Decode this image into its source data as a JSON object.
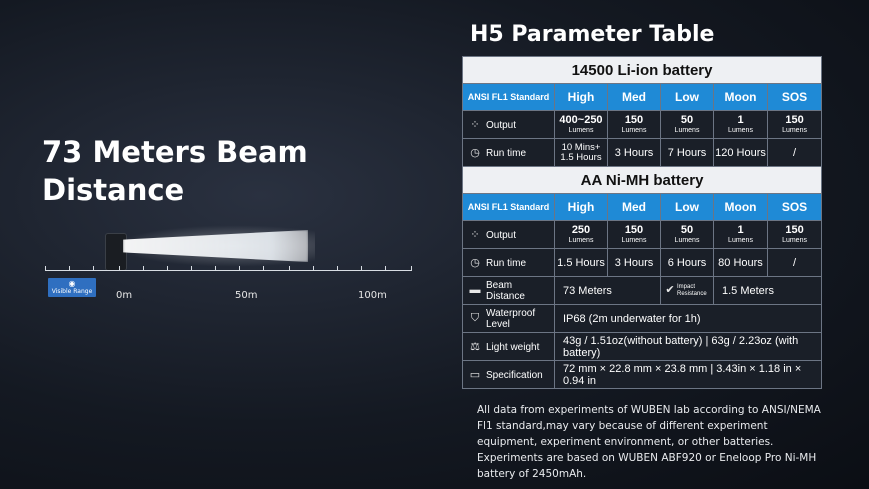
{
  "headline": {
    "line1": "73 Meters Beam",
    "line2": "Distance"
  },
  "scale": {
    "badge": "Visible Range",
    "marks": [
      "0m",
      "50m",
      "100m"
    ]
  },
  "title": "H5 Parameter Table",
  "battery1": {
    "name": "14500 Li-ion battery",
    "std": "ANSI FL1 Standard",
    "modes": [
      "High",
      "Med",
      "Low",
      "Moon",
      "SOS"
    ],
    "output_label": "Output",
    "output": [
      {
        "v": "400~250",
        "u": "Lumens"
      },
      {
        "v": "150",
        "u": "Lumens"
      },
      {
        "v": "50",
        "u": "Lumens"
      },
      {
        "v": "1",
        "u": "Lumens"
      },
      {
        "v": "150",
        "u": "Lumens"
      }
    ],
    "runtime_label": "Run time",
    "runtime": [
      "10 Mins+ 1.5 Hours",
      "3 Hours",
      "7 Hours",
      "120 Hours",
      "/"
    ]
  },
  "battery2": {
    "name": "AA Ni-MH battery",
    "std": "ANSI FL1 Standard",
    "modes": [
      "High",
      "Med",
      "Low",
      "Moon",
      "SOS"
    ],
    "output_label": "Output",
    "output": [
      {
        "v": "250",
        "u": "Lumens"
      },
      {
        "v": "150",
        "u": "Lumens"
      },
      {
        "v": "50",
        "u": "Lumens"
      },
      {
        "v": "1",
        "u": "Lumens"
      },
      {
        "v": "150",
        "u": "Lumens"
      }
    ],
    "runtime_label": "Run time",
    "runtime": [
      "1.5 Hours",
      "3 Hours",
      "6 Hours",
      "80 Hours",
      "/"
    ]
  },
  "specs": {
    "beam_label": "Beam Distance",
    "beam_value": "73 Meters",
    "impact_label": "Impact Resistance",
    "impact_value": "1.5 Meters",
    "waterproof_label": "Waterproof Level",
    "waterproof_value": "IP68 (2m underwater for 1h)",
    "weight_label": "Light weight",
    "weight_value": "43g / 1.51oz(without battery) | 63g / 2.23oz (with battery)",
    "spec_label": "Specification",
    "spec_value": "72 mm × 22.8 mm × 23.8 mm | 3.43in × 1.18 in × 0.94 in"
  },
  "note": "All data from experiments of WUBEN lab according to ANSI/NEMA Fl1 standard,may vary because of different experiment equipment, experiment environment, or other batteries. Experiments are based on WUBEN ABF920 or Eneloop Pro Ni-MH battery of 2450mAh."
}
